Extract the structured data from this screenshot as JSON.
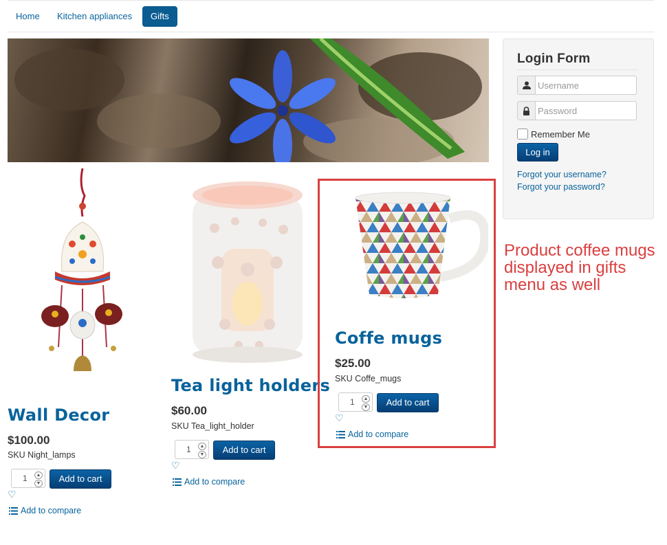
{
  "nav": {
    "items": [
      {
        "label": "Home",
        "active": false
      },
      {
        "label": "Kitchen appliances",
        "active": false
      },
      {
        "label": "Gifts",
        "active": true
      }
    ]
  },
  "login": {
    "title": "Login Form",
    "username_placeholder": "Username",
    "password_placeholder": "Password",
    "remember_label": "Remember Me",
    "login_button": "Log in",
    "forgot_username": "Forgot your username?",
    "forgot_password": "Forgot your password?"
  },
  "products": [
    {
      "title": "Wall Decor",
      "price": "$100.00",
      "sku": "SKU Night_lamps",
      "qty": "1",
      "cart_label": "Add to cart",
      "compare_label": "Add to compare"
    },
    {
      "title": "Tea light holders",
      "price": "$60.00",
      "sku": "SKU Tea_light_holder",
      "qty": "1",
      "cart_label": "Add to cart",
      "compare_label": "Add to compare"
    },
    {
      "title": "Coffe mugs",
      "price": "$25.00",
      "sku": "SKU Coffe_mugs",
      "qty": "1",
      "cart_label": "Add to cart",
      "compare_label": "Add to compare"
    }
  ],
  "annotation": "Product coffee mugs displayed in gifts menu as well",
  "colors": {
    "link": "#08639c",
    "accent": "#0b5c91",
    "highlight": "#d9403f"
  }
}
